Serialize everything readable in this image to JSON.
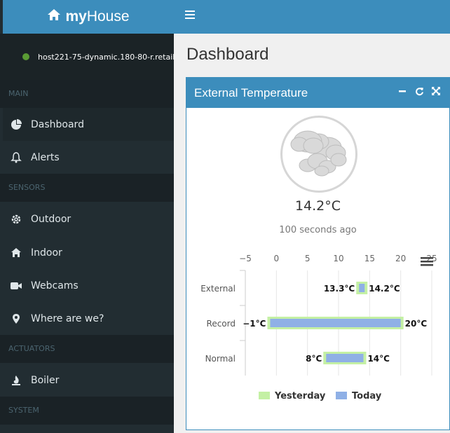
{
  "brand": {
    "prefix": "my",
    "name": "House"
  },
  "user": {
    "host": "host221-75-dynamic.180-80-r.retail.telecomitalia.it"
  },
  "sidebar": {
    "sections": [
      {
        "label": "MAIN"
      },
      {
        "label": "SENSORS"
      },
      {
        "label": "ACTUATORS"
      },
      {
        "label": "SYSTEM"
      }
    ],
    "items": [
      {
        "label": "Dashboard",
        "icon": "pie-chart-icon"
      },
      {
        "label": "Alerts",
        "icon": "bell-icon"
      },
      {
        "label": "Outdoor",
        "icon": "gear-icon"
      },
      {
        "label": "Indoor",
        "icon": "home-icon"
      },
      {
        "label": "Webcams",
        "icon": "video-camera-icon"
      },
      {
        "label": "Where are we?",
        "icon": "map-marker-icon"
      },
      {
        "label": "Boiler",
        "icon": "fire-icon"
      }
    ]
  },
  "page": {
    "title": "Dashboard"
  },
  "widget": {
    "title": "External Temperature",
    "temperature": "14.2°C",
    "updated": "100 seconds ago",
    "weather_icon": "cloudy-icon"
  },
  "colors": {
    "accent": "#3c8dbc",
    "sidebar_bg": "#222d32",
    "yesterday": "#c4f0a4",
    "today": "#8fb0e6"
  },
  "chart_data": {
    "type": "bar",
    "orientation": "horizontal-range",
    "categories": [
      "External",
      "Record",
      "Normal"
    ],
    "x_ticks": [
      -5,
      0,
      5,
      10,
      15,
      20,
      25
    ],
    "xlim": [
      -5,
      25
    ],
    "legend": "bottom",
    "series": [
      {
        "name": "Yesterday",
        "ranges": [
          [
            13.3,
            14.2
          ],
          [
            -1,
            20
          ],
          [
            8,
            14
          ]
        ]
      },
      {
        "name": "Today",
        "ranges": [
          [
            13.3,
            14.2
          ],
          [
            -1,
            20
          ],
          [
            8,
            14
          ]
        ]
      }
    ],
    "data_labels": [
      {
        "low": "13.3°C",
        "high": "14.2°C"
      },
      {
        "low": "−1°C",
        "high": "20°C"
      },
      {
        "low": "8°C",
        "high": "14°C"
      }
    ]
  }
}
